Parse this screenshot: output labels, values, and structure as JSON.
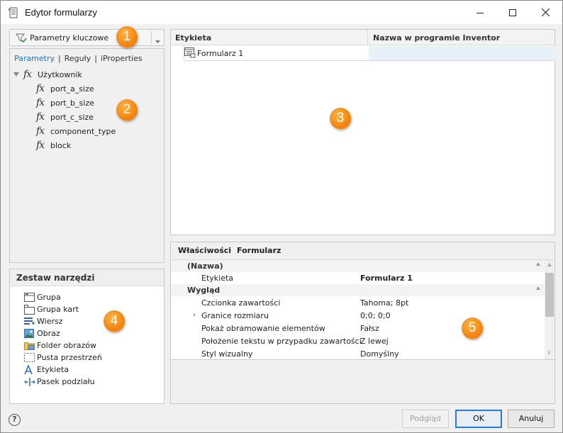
{
  "window": {
    "title": "Edytor formularzy"
  },
  "filter_dropdown": {
    "label": "Parametry kluczowe"
  },
  "tabs": [
    "Parametry",
    "Reguły",
    "iProperties"
  ],
  "tree": {
    "root": "Użytkownik",
    "fx_glyph": "fx",
    "items": [
      "port_a_size",
      "port_b_size",
      "port_c_size",
      "component_type",
      "block"
    ]
  },
  "toolbox": {
    "title": "Zestaw narzędzi",
    "items": [
      {
        "label": "Grupa",
        "icon": "group-icon"
      },
      {
        "label": "Grupa kart",
        "icon": "tab-group-icon"
      },
      {
        "label": "Wiersz",
        "icon": "row-icon"
      },
      {
        "label": "Obraz",
        "icon": "picture-icon"
      },
      {
        "label": "Folder obrazów",
        "icon": "picture-folder-icon"
      },
      {
        "label": "Pusta przestrzeń",
        "icon": "empty-space-icon"
      },
      {
        "label": "Etykieta",
        "icon": "label-icon"
      },
      {
        "label": "Pasek podziału",
        "icon": "splitter-icon"
      }
    ]
  },
  "grid": {
    "col1": "Etykieta",
    "col2": "Nazwa w programie Inventor",
    "rows": [
      {
        "label": "Formularz 1",
        "inventor_name": ""
      }
    ]
  },
  "properties": {
    "title": "Właściwości",
    "object": "Formularz",
    "rows": [
      {
        "type": "category",
        "name": "(Nazwa)"
      },
      {
        "type": "prop",
        "name": "Etykieta",
        "value": "Formularz 1",
        "bold": true
      },
      {
        "type": "category",
        "name": "Wygląd"
      },
      {
        "type": "prop",
        "name": "Czcionka zawartości",
        "value": "Tahoma; 8pt"
      },
      {
        "type": "prop",
        "name": "Granice rozmiaru",
        "value": "0;0; 0;0",
        "expandable": true
      },
      {
        "type": "prop",
        "name": "Pokaż obramowanie elementów",
        "value": "Fałsz"
      },
      {
        "type": "prop",
        "name": "Położenie tekstu w przypadku zawartości",
        "value": "Z lewej"
      },
      {
        "type": "prop",
        "name": "Styl wizualny",
        "value": "Domyślny"
      }
    ]
  },
  "buttons": {
    "preview": "Podgląd",
    "ok": "OK",
    "cancel": "Anuluj",
    "help": "?"
  },
  "callouts": [
    "1",
    "2",
    "3",
    "4",
    "5"
  ],
  "colors": {
    "accent_tab": "#1a78c2",
    "callout": "#f58a12",
    "selected_cell": "#e6f1fa",
    "default_button_border": "#2a7bd0"
  }
}
